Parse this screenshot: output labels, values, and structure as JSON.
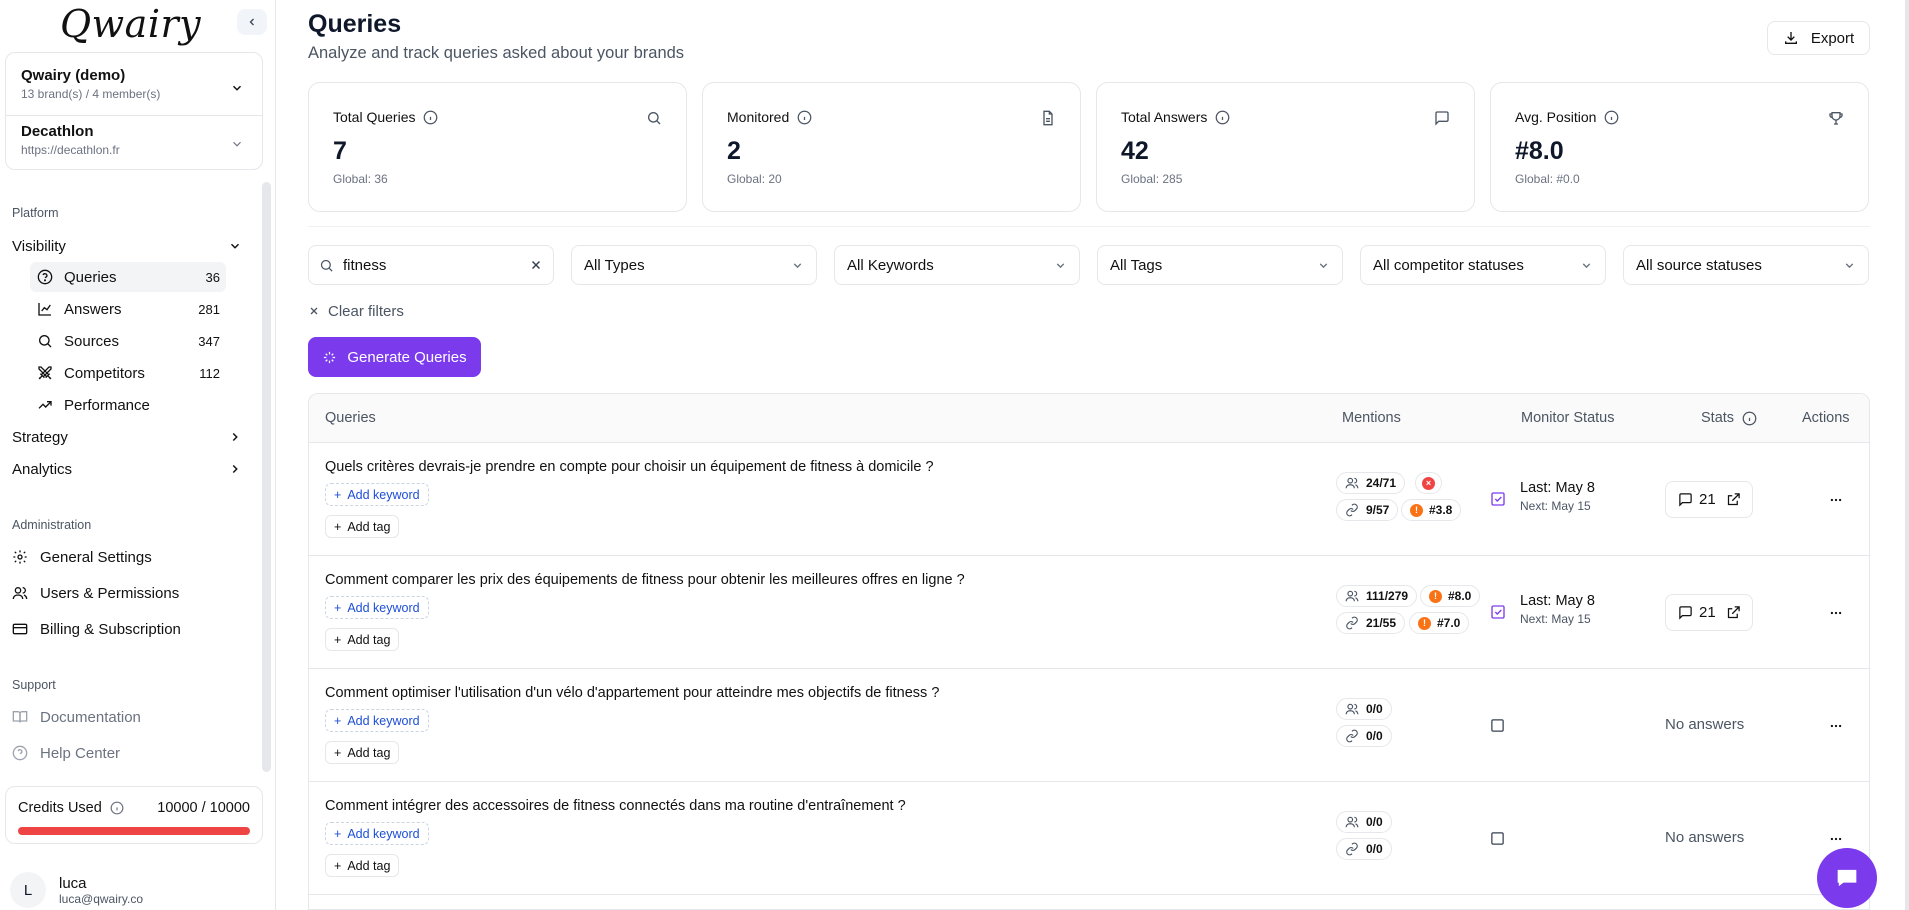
{
  "brand": {
    "logo_text": "Qwairy"
  },
  "workspace": {
    "name": "Qwairy (demo)",
    "meta": "13 brand(s) / 4 member(s)"
  },
  "brand_selector": {
    "name": "Decathlon",
    "url": "https://decathlon.fr"
  },
  "sidebar": {
    "platform_label": "Platform",
    "visibility_label": "Visibility",
    "visibility_items": [
      {
        "label": "Queries",
        "count": "36",
        "icon": "help-circle-icon"
      },
      {
        "label": "Answers",
        "count": "281",
        "icon": "line-chart-icon"
      },
      {
        "label": "Sources",
        "count": "347",
        "icon": "search-icon"
      },
      {
        "label": "Competitors",
        "count": "112",
        "icon": "swords-icon"
      },
      {
        "label": "Performance",
        "count": "",
        "icon": "trending-up-icon"
      }
    ],
    "strategy_label": "Strategy",
    "analytics_label": "Analytics",
    "admin_label": "Administration",
    "admin_items": [
      {
        "label": "General Settings",
        "icon": "gear-icon"
      },
      {
        "label": "Users & Permissions",
        "icon": "users-icon"
      },
      {
        "label": "Billing & Subscription",
        "icon": "credit-card-icon"
      }
    ],
    "support_label": "Support",
    "support_items": [
      {
        "label": "Documentation",
        "icon": "book-icon"
      },
      {
        "label": "Help Center",
        "icon": "help-circle-icon"
      }
    ]
  },
  "credits": {
    "label": "Credits Used",
    "value": "10000 / 10000",
    "used_fraction": 1.0,
    "bar_color": "#ef4444"
  },
  "user": {
    "initial": "L",
    "name": "luca",
    "email": "luca@qwairy.co"
  },
  "header": {
    "title": "Queries",
    "subtitle": "Analyze and track queries asked about your brands",
    "export_label": "Export"
  },
  "stats": [
    {
      "label": "Total Queries",
      "value": "7",
      "global": "Global:  36",
      "icon": "search-icon"
    },
    {
      "label": "Monitored",
      "value": "2",
      "global": "Global:  20",
      "icon": "file-text-icon"
    },
    {
      "label": "Total Answers",
      "value": "42",
      "global": "Global:  285",
      "icon": "message-square-icon"
    },
    {
      "label": "Avg. Position",
      "value": "#8.0",
      "global": "Global:  #0.0",
      "icon": "trophy-icon"
    }
  ],
  "filters": {
    "search_value": "fitness",
    "types": "All Types",
    "keywords": "All Keywords",
    "tags": "All Tags",
    "competitor": "All competitor statuses",
    "source": "All source statuses",
    "clear_label": "Clear filters",
    "generate_label": "Generate Queries"
  },
  "table": {
    "headers": {
      "queries": "Queries",
      "mentions": "Mentions",
      "monitor": "Monitor Status",
      "stats": "Stats",
      "actions": "Actions"
    },
    "add_keyword": "Add keyword",
    "add_tag": "Add tag",
    "no_answers": "No answers",
    "rows": [
      {
        "query": "Quels critères devrais-je prendre en compte pour choisir un équipement de fitness à domicile ?",
        "brand_mentions": "24/71",
        "brand_badge": "×",
        "brand_badge_type": "red",
        "source_mentions": "9/57",
        "source_badge": "#3.8",
        "monitored": true,
        "last": "Last: May 8",
        "next": "Next: May 15",
        "answers": "21"
      },
      {
        "query": "Comment comparer les prix des équipements de fitness pour obtenir les meilleures offres en ligne ?",
        "brand_mentions": "111/279",
        "brand_badge": "#8.0",
        "brand_badge_type": "orange",
        "source_mentions": "21/55",
        "source_badge": "#7.0",
        "monitored": true,
        "last": "Last: May 8",
        "next": "Next: May 15",
        "answers": "21"
      },
      {
        "query": "Comment optimiser l'utilisation d'un vélo d'appartement pour atteindre mes objectifs de fitness ?",
        "brand_mentions": "0/0",
        "source_mentions": "0/0",
        "monitored": false
      },
      {
        "query": "Comment intégrer des accessoires de fitness connectés dans ma routine d'entraînement ?",
        "brand_mentions": "0/0",
        "source_mentions": "0/0",
        "monitored": false
      }
    ]
  },
  "colors": {
    "accent": "#7c3aed",
    "danger": "#ef4444",
    "warning": "#f97316"
  }
}
